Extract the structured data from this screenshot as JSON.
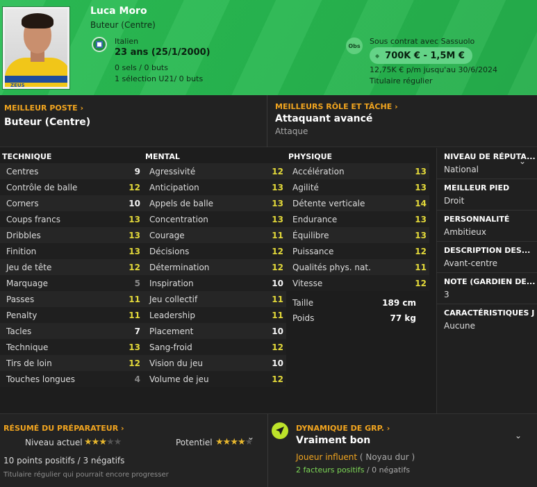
{
  "player": {
    "name": "Luca Moro",
    "position": "Buteur (Centre)",
    "nationality": "Italien",
    "age": "23 ans (25/1/2000)",
    "caps": "0 sels / 0 buts",
    "u21": "1 sélection U21/ 0 buts"
  },
  "contract": {
    "obs_label": "Obs",
    "label": "Sous contrat avec Sassuolo",
    "value": "700K € - 1,5M €",
    "wage": "12,75K € p/m jusqu'au 30/6/2024",
    "status": "Titulaire régulier"
  },
  "best_position": {
    "title": "MEILLEUR POSTE",
    "value": "Buteur (Centre)"
  },
  "best_role": {
    "title": "MEILLEURS RÔLE ET TÂCHE",
    "value": "Attaquant avancé",
    "duty": "Attaque"
  },
  "technical": {
    "title": "TECHNIQUE",
    "attrs": [
      {
        "name": "Centres",
        "value": "9"
      },
      {
        "name": "Contrôle de balle",
        "value": "12"
      },
      {
        "name": "Corners",
        "value": "10"
      },
      {
        "name": "Coups francs",
        "value": "13"
      },
      {
        "name": "Dribbles",
        "value": "13"
      },
      {
        "name": "Finition",
        "value": "13"
      },
      {
        "name": "Jeu de tête",
        "value": "12"
      },
      {
        "name": "Marquage",
        "value": "5"
      },
      {
        "name": "Passes",
        "value": "11"
      },
      {
        "name": "Penalty",
        "value": "11"
      },
      {
        "name": "Tacles",
        "value": "7"
      },
      {
        "name": "Technique",
        "value": "13"
      },
      {
        "name": "Tirs de loin",
        "value": "12"
      },
      {
        "name": "Touches longues",
        "value": "4"
      }
    ]
  },
  "mental": {
    "title": "MENTAL",
    "attrs": [
      {
        "name": "Agressivité",
        "value": "12"
      },
      {
        "name": "Anticipation",
        "value": "13"
      },
      {
        "name": "Appels de balle",
        "value": "13"
      },
      {
        "name": "Concentration",
        "value": "13"
      },
      {
        "name": "Courage",
        "value": "11"
      },
      {
        "name": "Décisions",
        "value": "12"
      },
      {
        "name": "Détermination",
        "value": "12"
      },
      {
        "name": "Inspiration",
        "value": "10"
      },
      {
        "name": "Jeu collectif",
        "value": "11"
      },
      {
        "name": "Leadership",
        "value": "11"
      },
      {
        "name": "Placement",
        "value": "10"
      },
      {
        "name": "Sang-froid",
        "value": "12"
      },
      {
        "name": "Vision du jeu",
        "value": "10"
      },
      {
        "name": "Volume de jeu",
        "value": "12"
      }
    ]
  },
  "physical": {
    "title": "PHYSIQUE",
    "attrs": [
      {
        "name": "Accélération",
        "value": "13"
      },
      {
        "name": "Agilité",
        "value": "13"
      },
      {
        "name": "Détente verticale",
        "value": "14"
      },
      {
        "name": "Endurance",
        "value": "13"
      },
      {
        "name": "Équilibre",
        "value": "13"
      },
      {
        "name": "Puissance",
        "value": "12"
      },
      {
        "name": "Qualités phys. nat.",
        "value": "11"
      },
      {
        "name": "Vitesse",
        "value": "12"
      }
    ],
    "height_label": "Taille",
    "height": "189 cm",
    "weight_label": "Poids",
    "weight": "77 kg"
  },
  "info": [
    {
      "label": "NIVEAU DE RÉPUTA...",
      "value": "National"
    },
    {
      "label": "MEILLEUR PIED",
      "value": "Droit"
    },
    {
      "label": "PERSONNALITÉ",
      "value": "Ambitieux"
    },
    {
      "label": "DESCRIPTION DES...",
      "value": "Avant-centre"
    },
    {
      "label": "NOTE (GARDIEN DE...",
      "value": "3"
    },
    {
      "label": "CARACTÉRISTIQUES J",
      "value": "Aucune"
    }
  ],
  "coach": {
    "title": "RÉSUMÉ DU PRÉPARATEUR",
    "current_label": "Niveau actuel",
    "current_stars": 3,
    "potential_label": "Potentiel",
    "potential_stars": 4,
    "points": "10 points positifs / 3 négatifs",
    "note": "Titulaire régulier qui pourrait encore progresser"
  },
  "dynamics": {
    "title": "DYNAMIQUE DE GRP.",
    "value": "Vraiment bon",
    "influence": "Joueur influent",
    "group": "( Noyau dur )",
    "positive": "2 facteurs positifs",
    "sep": "/",
    "negative": "0 négatifs"
  }
}
